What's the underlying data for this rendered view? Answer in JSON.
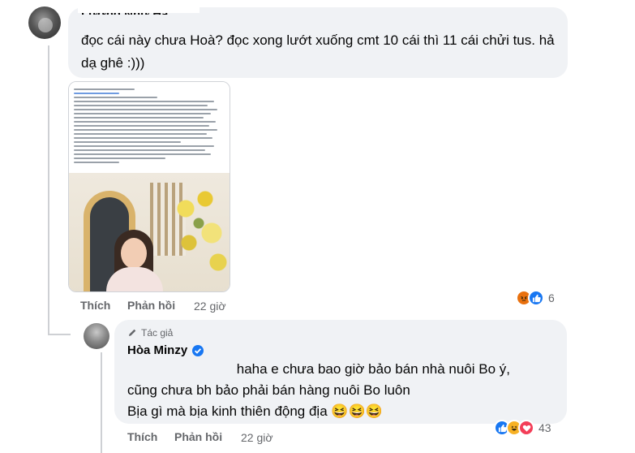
{
  "comment": {
    "author": "Lương Như Hà",
    "text": "đọc cái này chưa Hoà? đọc xong lướt xuống cmt 10 cái thì 11 cái chửi tus. hả dạ ghê :)))",
    "actions": {
      "like": "Thích",
      "reply": "Phản hồi",
      "time": "22 giờ"
    },
    "reactions": {
      "icons": [
        "angry",
        "like"
      ],
      "count": "6"
    }
  },
  "reply": {
    "badge": "Tác giả",
    "author": "Hòa Minzy",
    "line1": "haha e chưa bao giờ bảo bán nhà nuôi Bo ý,",
    "line2": "cũng chưa bh bảo phải bán hàng nuôi Bo luôn",
    "line3": "Bịa gì mà bịa kinh thiên động địa 😆😆😆",
    "actions": {
      "like": "Thích",
      "reply": "Phản hồi",
      "time": "22 giờ"
    },
    "reactions": {
      "icons": [
        "like",
        "haha",
        "love"
      ],
      "count": "43"
    }
  },
  "colors": {
    "bubble": "#f0f2f5",
    "meta": "#65676b",
    "like": "#1877f2",
    "angry": "#e9710f",
    "love": "#f33e58"
  }
}
